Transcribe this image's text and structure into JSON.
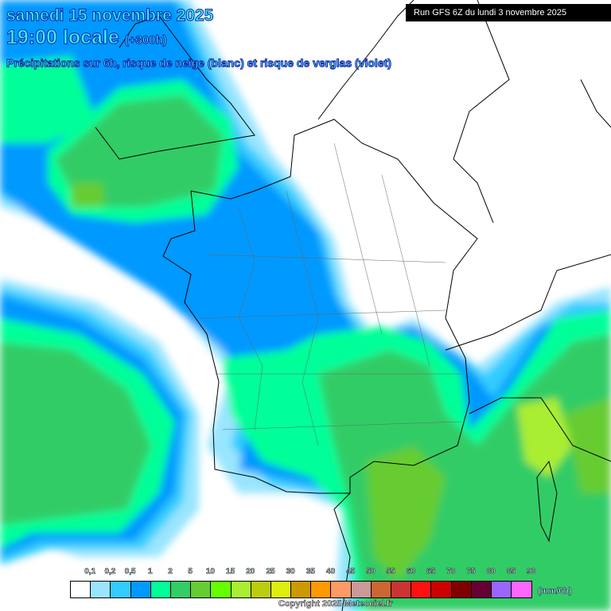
{
  "header": {
    "date": "samedi 15 novembre 2025",
    "time": "19:00 locale",
    "lead": "(+300h)",
    "subtitle": "Précipitations sur 6h, risque de neige (blanc) et risque de verglas (violet)",
    "run": "Run GFS 6Z du lundi 3 novembre 2025"
  },
  "legend": {
    "labels": [
      "0,1",
      "0,2",
      "0,5",
      "1",
      "2",
      "5",
      "10",
      "15",
      "20",
      "25",
      "30",
      "35",
      "40",
      "45",
      "50",
      "55",
      "60",
      "65",
      "70",
      "75",
      "80",
      "85",
      "90"
    ],
    "colors": [
      "#ffffff",
      "#99e5ff",
      "#33ccff",
      "#0099ff",
      "#00ff99",
      "#33cc66",
      "#66cc33",
      "#66ff00",
      "#aaee33",
      "#bbcc11",
      "#ddee11",
      "#cc9900",
      "#ff9900",
      "#ff9966",
      "#cc9999",
      "#cc6633",
      "#cc3333",
      "#ff1111",
      "#cc0000",
      "#800000",
      "#660033",
      "#9966ff",
      "#ff66ff"
    ],
    "unit": "(mm/6h)"
  },
  "footer": {
    "copyright": "Copyright 2025 Meteociel.fr"
  }
}
